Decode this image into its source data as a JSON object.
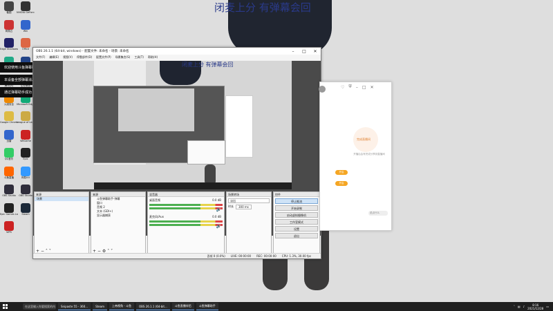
{
  "overlay": {
    "top_text": "闭麦上分 有弹幕会回",
    "preview_text": "闭麦上分 有弹幕会回"
  },
  "toasts": [
    "欢迎使用斗鱼弹幕助手",
    "本设备全部弹幕消息此机器播放",
    "通过弹幕助手成功"
  ],
  "desktop_icons": [
    {
      "label": "截图",
      "color": "#444"
    },
    {
      "label": "NVIDIA GeForce",
      "color": "#333"
    },
    {
      "label": "网易云",
      "color": "#c33"
    },
    {
      "label": "Win",
      "color": "#36c"
    },
    {
      "label": "Edge Shadowsocks",
      "color": "#226"
    },
    {
      "label": "Office",
      "color": "#d64"
    },
    {
      "label": "Tencent",
      "color": "#2a8"
    },
    {
      "label": "InstallXHX",
      "color": "#248"
    },
    {
      "label": "腾讯QQ",
      "color": "#2af"
    },
    {
      "label": "企业微信",
      "color": "#29c"
    },
    {
      "label": "火绒安全",
      "color": "#e80"
    },
    {
      "label": "Microsoft Edge",
      "color": "#1a7"
    },
    {
      "label": "Google Chrome",
      "color": "#db4"
    },
    {
      "label": "League of Legends",
      "color": "#ca4"
    },
    {
      "label": "迅雷",
      "color": "#36c"
    },
    {
      "label": "WeGame",
      "color": "#c22"
    },
    {
      "label": "QQ音乐",
      "color": "#3c6"
    },
    {
      "label": "Epic",
      "color": "#222"
    },
    {
      "label": "斗鱼直播",
      "color": "#f60"
    },
    {
      "label": "网易UU",
      "color": "#39f"
    },
    {
      "label": "OBS Studio",
      "color": "#302e3c"
    },
    {
      "label": "OBS Studio",
      "color": "#302e3c"
    },
    {
      "label": "Epic Games Launcher",
      "color": "#222"
    },
    {
      "label": "Steam",
      "color": "#1b2838"
    },
    {
      "label": "WPS",
      "color": "#c22"
    }
  ],
  "obs": {
    "title": "OBS 26.1.1 (64-bit, windows) - 配置文件: 未命名 - 场景: 未命名",
    "menus": [
      "文件(F)",
      "编辑(E)",
      "视图(V)",
      "停靠部件(D)",
      "配置文件(P)",
      "场景集合(S)",
      "工具(T)",
      "帮助(H)"
    ],
    "scenes_header": "来源",
    "scenes_sub": "场景",
    "sources_header": "来源",
    "sources": [
      "斗鱼弹幕助手-弹幕",
      "窗口",
      "音频 2",
      "文本 (GDI+)",
      "显示器捕获"
    ],
    "mixer_header": "混音器",
    "mixer": [
      {
        "name": "桌面音频",
        "db": "0.0 dB"
      },
      {
        "name": "麦克风/Aux",
        "db": "0.0 dB"
      }
    ],
    "transitions_header": "场景转场",
    "transition_value": "淡出",
    "duration_label": "时长",
    "duration_value": "300 ms",
    "controls_header": "控件",
    "controls": [
      "停止推流",
      "开始录制",
      "启动虚拟摄像机",
      "工作室模式",
      "设置",
      "退出"
    ],
    "status": [
      "丢帧 0 (0.0%)",
      "LIVE: 00:00:00",
      "REC: 00:00:00",
      "CPU: 1.3%, 30.00 fps"
    ]
  },
  "side_app": {
    "note1": "完成直播间",
    "note2": "开播后会有完成分享到直播间",
    "toggle_labels": [
      "开启",
      "开启"
    ],
    "input_placeholder": "说点什么"
  },
  "taskbar": {
    "search": "在这里输入你要搜索的内容",
    "items": [
      "Snipaste 55 - 360...",
      "Steam",
      "上帝视角 - 斗鱼",
      "OBS 26.1.1 (64-bit...",
      "斗鱼直播伴侣",
      "斗鱼弹幕助手"
    ],
    "time": "8:16",
    "date": "2021/12/28"
  }
}
